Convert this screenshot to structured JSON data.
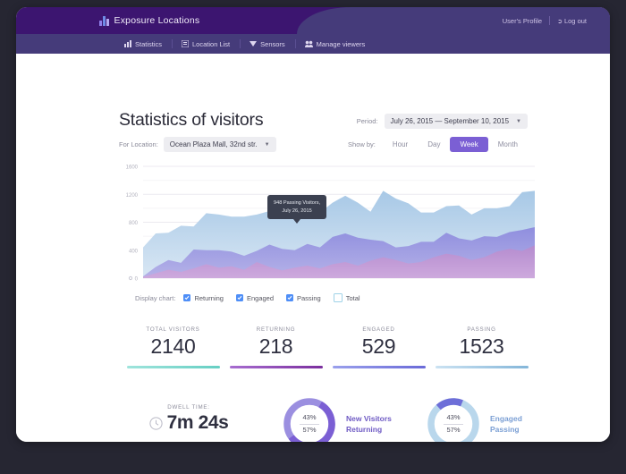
{
  "topbar": {
    "brand": "Exposure Locations",
    "logo_icon": "bar-chart-icon",
    "profile_link": "User's Profile",
    "logout_link": "Log out",
    "logout_icon": "logout-icon"
  },
  "nav": {
    "items": [
      {
        "label": "Statistics",
        "icon": "chart-icon"
      },
      {
        "label": "Location List",
        "icon": "list-icon"
      },
      {
        "label": "Sensors",
        "icon": "sensor-icon"
      },
      {
        "label": "Manage viewers",
        "icon": "users-icon"
      }
    ]
  },
  "page": {
    "title": "Statistics of visitors",
    "location_label": "For Location:",
    "location_value": "Ocean Plaza Mall, 32nd str.",
    "period_label": "Period:",
    "period_value": "July 26, 2015 — September 10, 2015",
    "showby_label": "Show by:",
    "showby_options": [
      "Hour",
      "Day",
      "Week",
      "Month"
    ],
    "showby_selected": "Week"
  },
  "legend": {
    "label": "Display chart:",
    "items": [
      {
        "label": "Returning",
        "checked": true
      },
      {
        "label": "Engaged",
        "checked": true
      },
      {
        "label": "Passing",
        "checked": true
      },
      {
        "label": "Total",
        "checked": false
      }
    ]
  },
  "tooltip": {
    "line1": "948 Passing Visitors,",
    "line2": "July 26, 2015"
  },
  "kpis": [
    {
      "label": "Total Visitors",
      "value": "2140",
      "color": "#7fd8cf"
    },
    {
      "label": "Returning",
      "value": "218",
      "color": "#8d57b8"
    },
    {
      "label": "Engaged",
      "value": "529",
      "color": "#7b7ee0"
    },
    {
      "label": "Passing",
      "value": "1523",
      "color": "#a9cfe8"
    }
  ],
  "dwell": {
    "label": "Dwell Time:",
    "value": "7m 24s",
    "icon": "clock-icon"
  },
  "donuts": [
    {
      "name": "new-visitors-returning",
      "top_pct": "43%",
      "bottom_pct": "57%",
      "legend_line1": "New Visitors",
      "legend_line2": "Returning",
      "track_color": "#9b8fe0",
      "value_color": "#7b5fd4",
      "text_color": "#6f5bc4",
      "value": 57
    },
    {
      "name": "engaged-passing",
      "top_pct": "43%",
      "bottom_pct": "57%",
      "legend_line1": "Engaged",
      "legend_line2": "Passing",
      "track_color": "#b9d7ec",
      "value_color": "#6d6ed8",
      "text_color": "#7b9fd4",
      "value": 18
    }
  ],
  "chart_data": {
    "type": "area",
    "title": "",
    "xlabel": "",
    "ylabel": "",
    "ylim": [
      0,
      1600
    ],
    "yticks": [
      0,
      400,
      800,
      1200,
      1600
    ],
    "grid": true,
    "legend_position": "below",
    "stacked": true,
    "x": [
      1,
      2,
      3,
      4,
      5,
      6,
      7,
      8,
      9,
      10,
      11,
      12,
      13,
      14,
      15,
      16,
      17,
      18,
      19,
      20,
      21,
      22,
      23,
      24,
      25,
      26,
      27,
      28,
      29,
      30,
      31,
      32
    ],
    "series": [
      {
        "name": "Returning",
        "color": "#b58ccf",
        "values": [
          20,
          70,
          120,
          90,
          140,
          200,
          150,
          170,
          120,
          230,
          160,
          110,
          150,
          180,
          140,
          200,
          230,
          180,
          250,
          300,
          260,
          210,
          230,
          300,
          350,
          320,
          260,
          300,
          380,
          420,
          390,
          470
        ]
      },
      {
        "name": "Engaged",
        "color": "#8f8ede",
        "values": [
          5,
          90,
          140,
          130,
          270,
          200,
          250,
          210,
          200,
          160,
          320,
          310,
          250,
          310,
          300,
          390,
          410,
          400,
          300,
          230,
          180,
          250,
          290,
          220,
          300,
          250,
          280,
          300,
          210,
          240,
          300,
          260
        ]
      },
      {
        "name": "Passing",
        "color": "#a7c8e6",
        "values": [
          415,
          480,
          390,
          530,
          330,
          530,
          510,
          500,
          560,
          520,
          480,
          480,
          580,
          560,
          500,
          490,
          540,
          500,
          400,
          720,
          700,
          610,
          420,
          420,
          380,
          470,
          370,
          400,
          410,
          370,
          540,
          520
        ]
      }
    ],
    "tooltip_point": {
      "series": "Passing",
      "value": 948,
      "label": "July 26, 2015"
    }
  }
}
